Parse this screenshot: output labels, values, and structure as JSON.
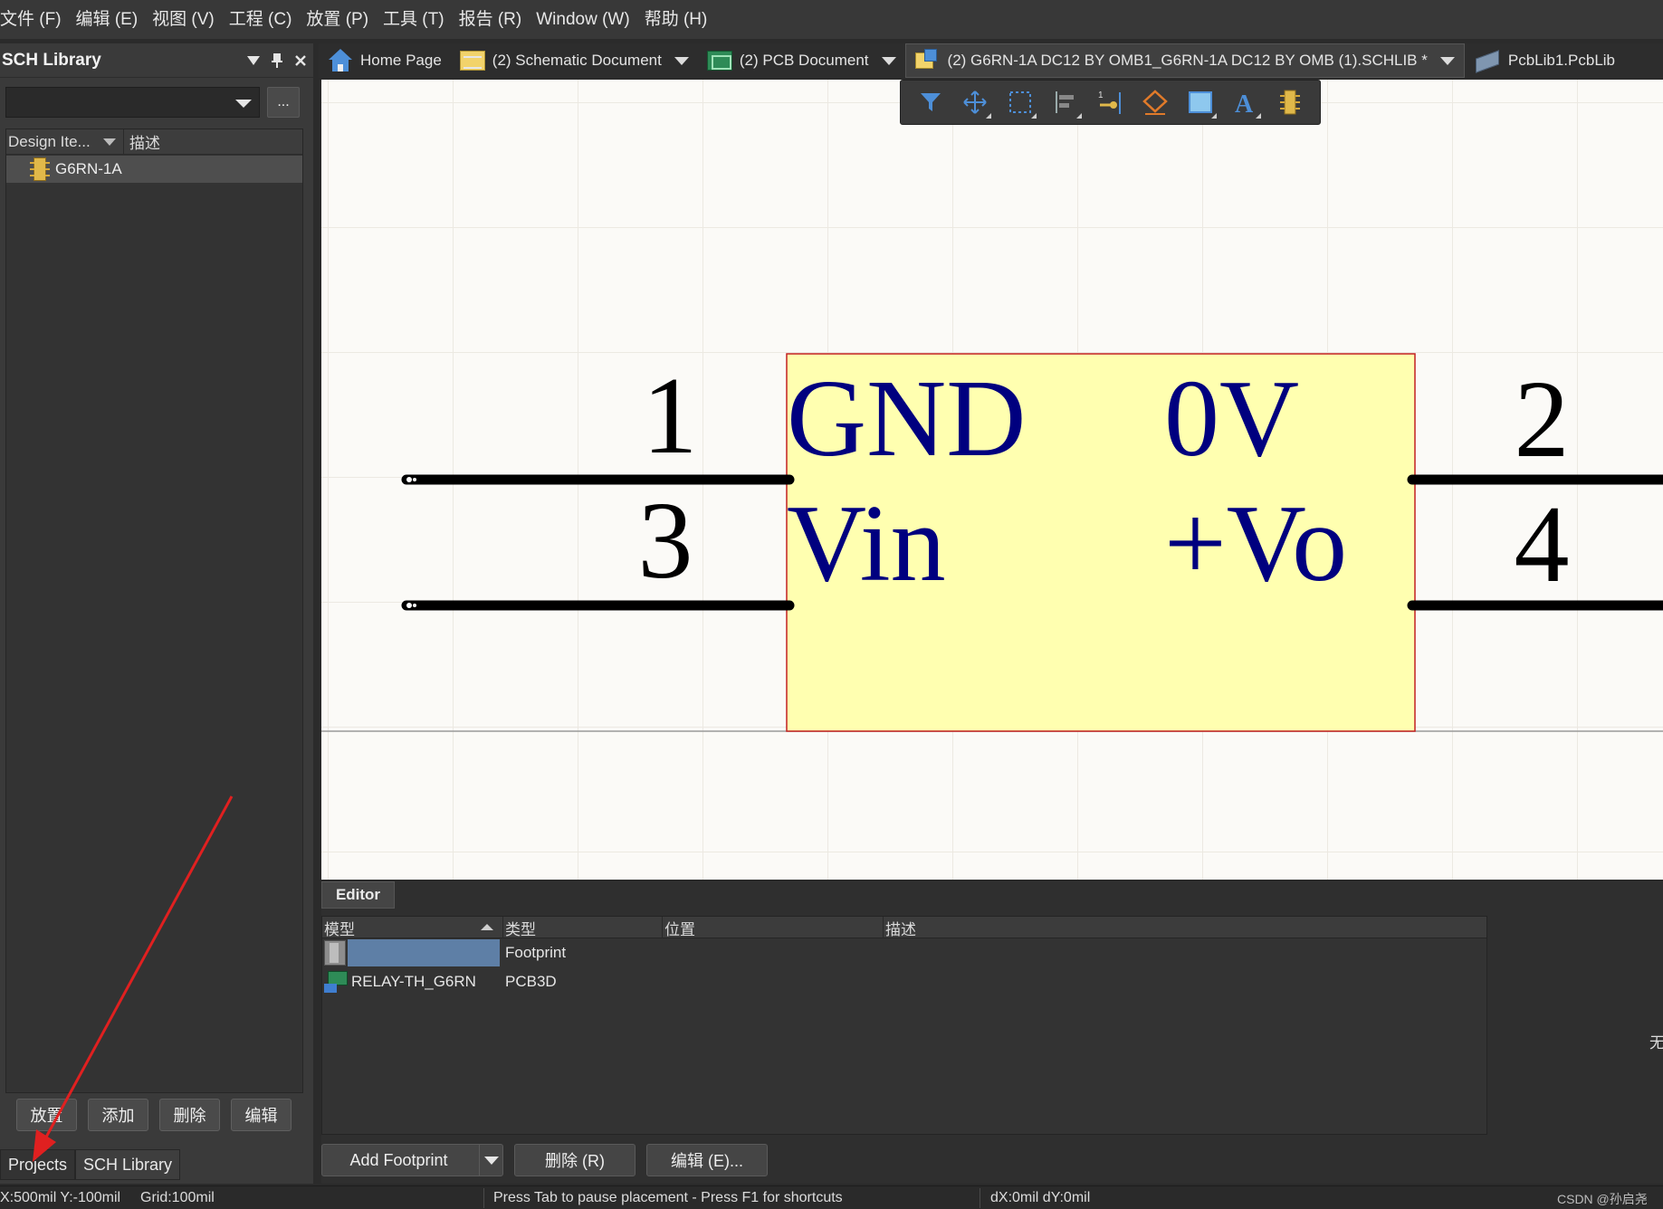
{
  "menubar": {
    "items": [
      "文件 (F)",
      "编辑 (E)",
      "视图 (V)",
      "工程 (C)",
      "放置 (P)",
      "工具 (T)",
      "报告 (R)",
      "Window (W)",
      "帮助 (H)"
    ]
  },
  "left_panel": {
    "title": "SCH Library",
    "browse_label": "...",
    "columns": {
      "design_item": "Design Ite...",
      "description": "描述"
    },
    "items": [
      {
        "name": "G6RN-1A",
        "icon": "component-icon"
      }
    ],
    "buttons": {
      "place": "放置",
      "add": "添加",
      "delete": "删除",
      "edit": "编辑"
    },
    "bottom_tabs": {
      "projects": "Projects",
      "sch_library": "SCH Library"
    }
  },
  "doc_tabs": [
    {
      "label": "Home Page",
      "icon": "home-icon"
    },
    {
      "label": "(2) Schematic Document",
      "icon": "schematic-icon"
    },
    {
      "label": "(2) PCB Document",
      "icon": "pcb-icon"
    },
    {
      "label": "(2) G6RN-1A DC12 BY OMB1_G6RN-1A DC12 BY OMB (1).SCHLIB *",
      "icon": "schlib-icon",
      "active": true
    },
    {
      "label": "PcbLib1.PcbLib",
      "icon": "pcblib-icon"
    }
  ],
  "float_toolbar": {
    "tools": [
      "filter-icon",
      "move-icon",
      "select-icon",
      "align-icon",
      "pin-icon",
      "polygon-icon",
      "rectangle-icon",
      "text-icon",
      "part-icon"
    ]
  },
  "schematic": {
    "body_color": "#ffffb0",
    "body_border": "#c22020",
    "pin_name_color": "#00007f",
    "pins": [
      {
        "number": "1",
        "name": "GND"
      },
      {
        "number": "2",
        "name": "0V"
      },
      {
        "number": "3",
        "name": "Vin"
      },
      {
        "number": "4",
        "name": "+Vo"
      }
    ]
  },
  "editor": {
    "tab_label": "Editor",
    "columns": {
      "model": "模型",
      "type": "类型",
      "location": "位置",
      "description": "描述"
    },
    "rows": [
      {
        "model": "",
        "type": "Footprint",
        "icon": "footprint-icon",
        "selected": true
      },
      {
        "model": "RELAY-TH_G6RN",
        "type": "PCB3D",
        "icon": "pcb3d-icon",
        "selected": false
      }
    ],
    "buttons": {
      "add_footprint": "Add Footprint",
      "delete": "删除 (R)",
      "edit": "编辑 (E)..."
    },
    "side_char": "无"
  },
  "statusbar": {
    "coords": "X:500mil Y:-100mil",
    "grid": "Grid:100mil",
    "message": "Press Tab to pause placement - Press F1 for shortcuts",
    "delta": "dX:0mil dY:0mil",
    "watermark": "CSDN @孙启尧"
  },
  "colors": {
    "accent_blue": "#4d8fd8",
    "selection": "#5e7fa6",
    "annotation_arrow": "#e02020"
  }
}
